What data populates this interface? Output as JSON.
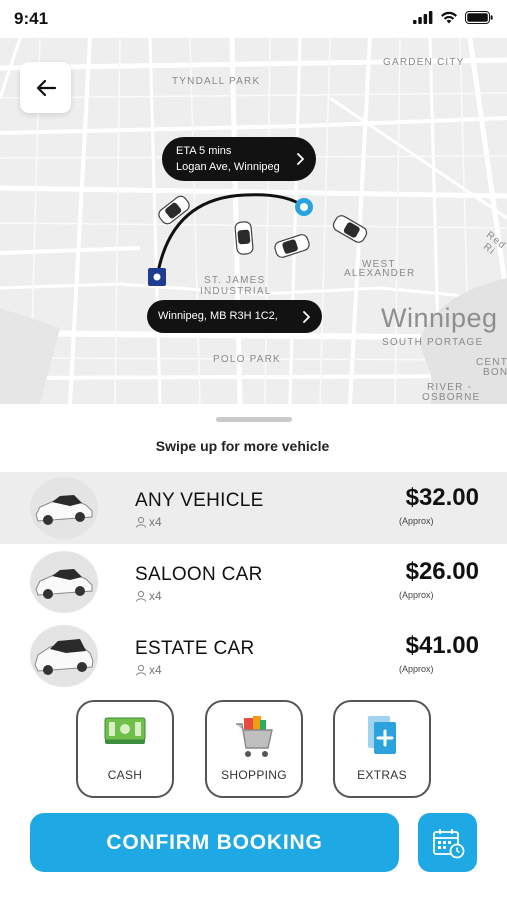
{
  "status_bar": {
    "time": "9:41"
  },
  "map": {
    "labels": {
      "tyndall_park": "TYNDALL PARK",
      "garden_city": "GARDEN CITY",
      "st_james_1": "ST. JAMES",
      "st_james_2": "INDUSTRIAL",
      "west_alexander_1": "WEST",
      "west_alexander_2": "ALEXANDER",
      "polo_park": "POLO PARK",
      "south_portage": "SOUTH PORTAGE",
      "river_osborne_1": "RIVER -",
      "river_osborne_2": "OSBORNE",
      "centre_bon_1": "CENT",
      "centre_bon_2": "BON",
      "red_river": "Red Ri"
    },
    "city": "Winnipeg",
    "eta_line1": "ETA 5 mins",
    "eta_line2": "Logan Ave, Winnipeg",
    "destination": "Winnipeg, MB R3H 1C2,"
  },
  "sheet": {
    "swipe_hint": "Swipe up for more vehicle",
    "vehicles": [
      {
        "name": "ANY VEHICLE",
        "seats": "x4",
        "price": "$32.00",
        "note": "(Approx)",
        "selected": true
      },
      {
        "name": "SALOON CAR",
        "seats": "x4",
        "price": "$26.00",
        "note": "(Approx)",
        "selected": false
      },
      {
        "name": "ESTATE CAR",
        "seats": "x4",
        "price": "$41.00",
        "note": "(Approx)",
        "selected": false
      }
    ],
    "options": [
      {
        "label": "CASH",
        "icon": "cash-icon"
      },
      {
        "label": "SHOPPING",
        "icon": "shopping-cart-icon"
      },
      {
        "label": "EXTRAS",
        "icon": "extras-add-icon"
      }
    ],
    "confirm_label": "CONFIRM BOOKING",
    "calendar_icon": "calendar-clock-icon"
  },
  "colors": {
    "accent": "#1ea8e4",
    "pill": "#121212",
    "route_start": "#29a3e0",
    "route_end": "#1f3c8f"
  }
}
